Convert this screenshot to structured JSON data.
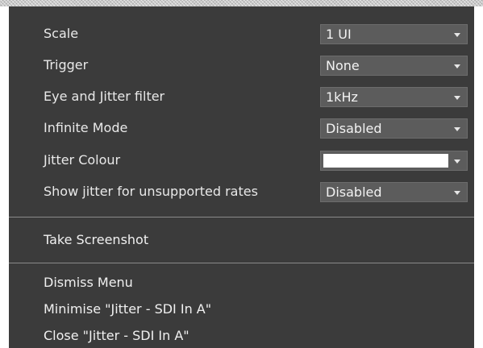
{
  "settings": [
    {
      "label": "Scale",
      "value": "1 UI"
    },
    {
      "label": "Trigger",
      "value": "None"
    },
    {
      "label": "Eye and Jitter filter",
      "value": "1kHz"
    },
    {
      "label": "Infinite Mode",
      "value": "Disabled"
    },
    {
      "label": "Jitter Colour",
      "value": "",
      "swatch_color": "#ffffff"
    },
    {
      "label": "Show jitter for unsupported rates",
      "value": "Disabled"
    }
  ],
  "actions": {
    "screenshot": "Take Screenshot",
    "dismiss": "Dismiss Menu",
    "minimise": "Minimise \"Jitter - SDI In A\"",
    "close": "Close \"Jitter - SDI In A\""
  },
  "colors": {
    "menu_background": "#3b3b3b",
    "dropdown_background": "#5c5c5c",
    "text": "#e9e9e9",
    "separator": "#8a8a8a"
  }
}
